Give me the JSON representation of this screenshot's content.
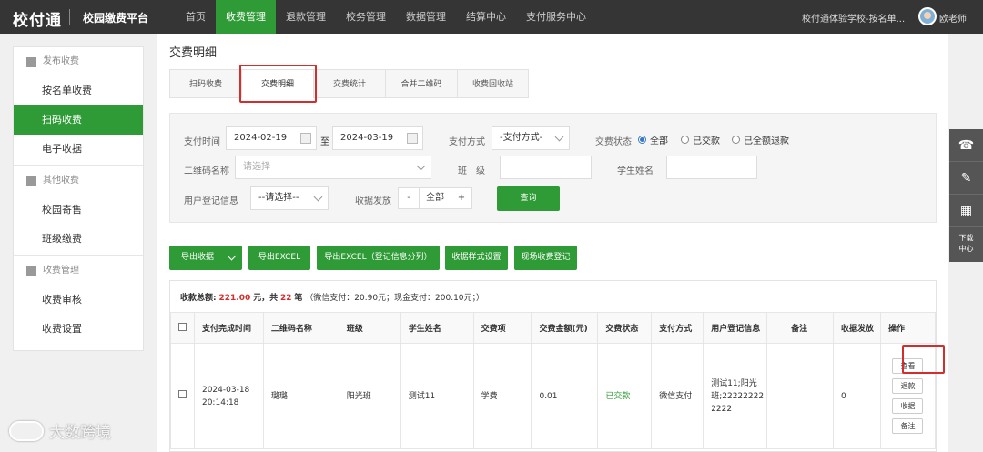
{
  "topbar": {
    "logo": "校付通",
    "platform": "校园缴费平台",
    "nav": [
      "首页",
      "收费管理",
      "退款管理",
      "校务管理",
      "数据管理",
      "结算中心",
      "支付服务中心"
    ],
    "active_nav": "收费管理",
    "school": "校付通体验学校-按名单...",
    "user": "欧老师"
  },
  "sidebar": {
    "groups": [
      {
        "title": "发布收费",
        "icon": "edit-icon",
        "items": [
          "按名单收费",
          "扫码收费",
          "电子收据"
        ]
      },
      {
        "title": "其他收费",
        "icon": "grid-icon",
        "items": [
          "校园寄售",
          "班级缴费"
        ]
      },
      {
        "title": "收费管理",
        "icon": "settings-icon",
        "items": [
          "收费审核",
          "收费设置"
        ]
      }
    ],
    "active_item": "扫码收费"
  },
  "page": {
    "title": "交费明细"
  },
  "tabs": [
    "扫码收费",
    "交费明细",
    "交费统计",
    "合并二维码",
    "收费回收站"
  ],
  "active_tab": "交费明细",
  "filters": {
    "pay_time_label": "支付时间",
    "date_from": "2024-02-19",
    "date_to": "2024-03-19",
    "to_label": "至",
    "pay_method_label": "支付方式",
    "pay_method_value": "-支付方式-",
    "status_label": "交费状态",
    "status_options": [
      "全部",
      "已交款",
      "已全额退款"
    ],
    "status_selected": "全部",
    "qr_label": "二维码名称",
    "qr_placeholder": "请选择",
    "class_label": "班　级",
    "student_label": "学生姓名",
    "reg_label": "用户登记信息",
    "reg_value": "--请选择--",
    "receipt_label": "收据发放",
    "receipt_minus": "-",
    "receipt_value": "全部",
    "receipt_plus": "+",
    "query_button": "查询"
  },
  "actions": [
    "导出收据",
    "导出EXCEL",
    "导出EXCEL（登记信息分列）",
    "收据样式设置",
    "现场收费登记"
  ],
  "summary": {
    "label": "收款总额:",
    "amount": "221.00",
    "unit": "元，共",
    "count": "22",
    "count_unit": "笔",
    "detail": "（微信支付：20.90元；现金支付：200.10元；）"
  },
  "table": {
    "headers": [
      "支付完成时间",
      "二维码名称",
      "班级",
      "学生姓名",
      "交费项",
      "交费金额(元)",
      "交费状态",
      "支付方式",
      "用户登记信息",
      "备注",
      "收据发放",
      "操作"
    ],
    "rows": [
      {
        "time": "2024-03-18 20:14:18",
        "qr_name": "璐璐",
        "class": "阳光班",
        "student": "测试11",
        "item": "学费",
        "amount": "0.01",
        "status": "已交款",
        "method": "微信支付",
        "reg_info": "测试11;阳光班;222222222222",
        "remark": "",
        "receipt": "0"
      }
    ],
    "ops": [
      "查看",
      "退款",
      "收据",
      "备注"
    ]
  },
  "float_bar": {
    "download_label": "下载中心"
  },
  "watermark": "大数跨境",
  "colors": {
    "brand_green": "#2f9b36",
    "highlight_red": "#d42d2d",
    "topbar": "#353535"
  }
}
